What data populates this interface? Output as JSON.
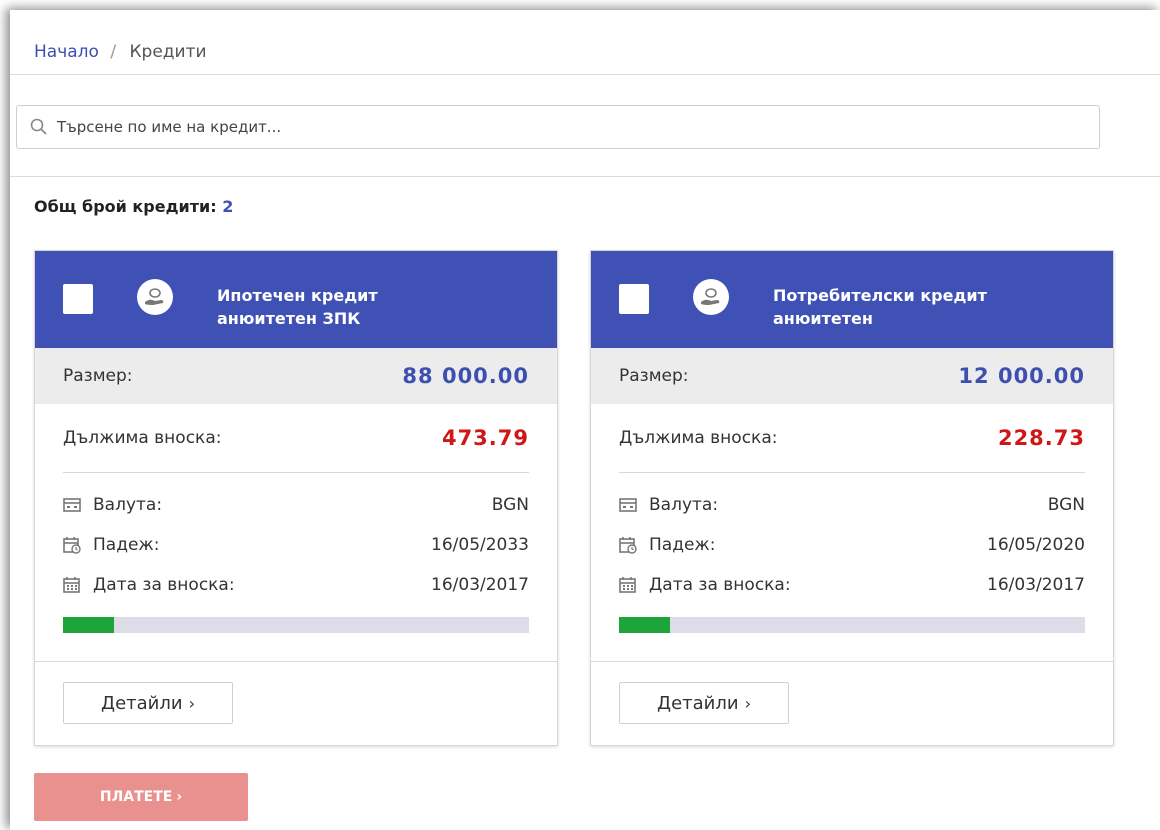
{
  "breadcrumb": {
    "home": "Начало",
    "separator": "/",
    "current": "Кредити"
  },
  "search": {
    "placeholder": "Търсене по име на кредит...",
    "value": "",
    "icon": "search-icon"
  },
  "summary": {
    "label": "Общ брой кредити:",
    "count": "2"
  },
  "colors": {
    "header": "#3f51b5",
    "amount": "#3d4fb0",
    "due": "#d01717",
    "progress": "#1fa43a",
    "pay_button": "#e8918f"
  },
  "cards": [
    {
      "title_line1": "Ипотечен кредит",
      "title_line2": "анюитетен ЗПК",
      "icon": "hand-coin-icon",
      "size_label": "Размер:",
      "size_value": "88 000.00",
      "due_label": "Дължима вноска:",
      "due_value": "473.79",
      "currency_label": "Валута:",
      "currency_value": "BGN",
      "maturity_label": "Падеж:",
      "maturity_value": "16/05/2033",
      "payment_date_label": "Дата за вноска:",
      "payment_date_value": "16/03/2017",
      "progress_percent": 11,
      "details_label": "Детайли",
      "details_chevron": "›"
    },
    {
      "title_line1": "Потребителски кредит",
      "title_line2": "анюитетен",
      "icon": "hand-coin-icon",
      "size_label": "Размер:",
      "size_value": "12 000.00",
      "due_label": "Дължима вноска:",
      "due_value": "228.73",
      "currency_label": "Валута:",
      "currency_value": "BGN",
      "maturity_label": "Падеж:",
      "maturity_value": "16/05/2020",
      "payment_date_label": "Дата за вноска:",
      "payment_date_value": "16/03/2017",
      "progress_percent": 11,
      "details_label": "Детайли",
      "details_chevron": "›"
    }
  ],
  "pay_button": {
    "label": "ПЛАТЕТЕ",
    "chevron": "›"
  }
}
